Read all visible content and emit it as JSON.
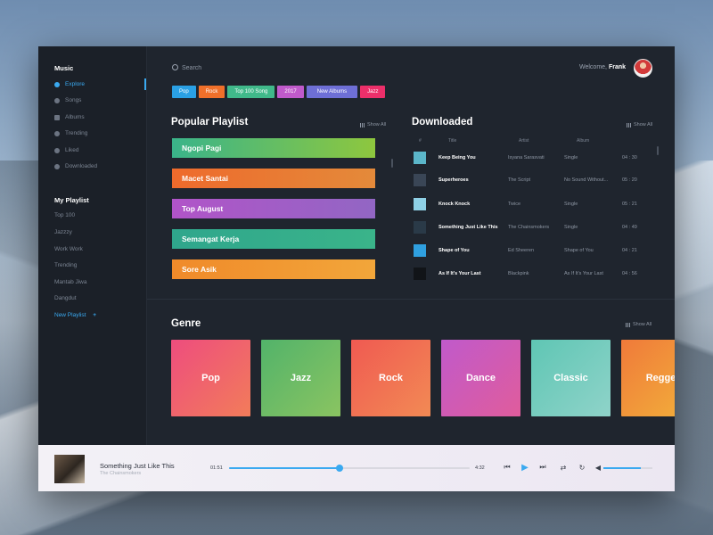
{
  "sidebar": {
    "title": "Music",
    "items": [
      {
        "label": "Explore",
        "icon": "compass-icon",
        "active": true
      },
      {
        "label": "Songs",
        "icon": "music-note-icon"
      },
      {
        "label": "Albums",
        "icon": "album-icon"
      },
      {
        "label": "Trending",
        "icon": "star-icon"
      },
      {
        "label": "Liked",
        "icon": "heart-icon"
      },
      {
        "label": "Downloaded",
        "icon": "cloud-download-icon"
      }
    ],
    "my_playlist_title": "My Playlist",
    "playlists": [
      "Top 100",
      "Jazzzy",
      "Work Work",
      "Trending",
      "Mantab Jiwa",
      "Dangdut"
    ],
    "new_playlist_label": "New Playlist",
    "new_playlist_plus": "+"
  },
  "header": {
    "search_placeholder": "Search",
    "welcome_prefix": "Welcome, ",
    "user_name": "Frank"
  },
  "tags": [
    {
      "label": "Pop",
      "color": "#2aa0e4"
    },
    {
      "label": "Rock",
      "color": "#f0702a"
    },
    {
      "label": "Top 100 Song",
      "color": "#40b98a"
    },
    {
      "label": "2017",
      "color": "#c05acb"
    },
    {
      "label": "New Albums",
      "color": "#6e6fd6"
    },
    {
      "label": "Jazz",
      "color": "#ec2f6a"
    }
  ],
  "popular": {
    "title": "Popular Playlist",
    "show_all": "Show All",
    "items": [
      {
        "label": "Ngopi Pagi",
        "from": "#3ab48a",
        "to": "#8ec73e"
      },
      {
        "label": "Macet Santai",
        "from": "#ee6a2c",
        "to": "#e48a3a"
      },
      {
        "label": "Top August",
        "from": "#b154c8",
        "to": "#9266c4"
      },
      {
        "label": "Semangat Kerja",
        "from": "#2fa68c",
        "to": "#3ab48a"
      },
      {
        "label": "Sore Asik",
        "from": "#f08a2a",
        "to": "#f2a63a"
      }
    ]
  },
  "downloaded": {
    "title": "Downloaded",
    "show_all": "Show All",
    "headers": {
      "num": "#",
      "title": "Title",
      "artist": "Artist",
      "album": "Album"
    },
    "rows": [
      {
        "title": "Keep Being You",
        "artist": "Isyana Sarasvati",
        "album": "Single",
        "time": "04 : 30",
        "thumb": "#5bb6c9"
      },
      {
        "title": "Superheroes",
        "artist": "The Script",
        "album": "No Sound Without...",
        "time": "05 : 20",
        "thumb": "#3a4656"
      },
      {
        "title": "Knock Knock",
        "artist": "Twice",
        "album": "Single",
        "time": "05 : 21",
        "thumb": "#8fd1e6"
      },
      {
        "title": "Something Just Like This",
        "artist": "The Chainsmokers",
        "album": "Single",
        "time": "04 : 49",
        "thumb": "#2a3a48"
      },
      {
        "title": "Shape of You",
        "artist": "Ed Sheeren",
        "album": "Shape of You",
        "time": "04 : 21",
        "thumb": "#2fa0e0"
      },
      {
        "title": "As If It's Your Last",
        "artist": "Blackpink",
        "album": "As If It's Your Last",
        "time": "04 : 56",
        "thumb": "#111418"
      }
    ]
  },
  "genre": {
    "title": "Genre",
    "show_all": "Show All",
    "items": [
      {
        "label": "Pop",
        "from": "#ee4d7e",
        "to": "#f27c5a"
      },
      {
        "label": "Jazz",
        "from": "#52b36a",
        "to": "#8ac461"
      },
      {
        "label": "Rock",
        "from": "#f05a52",
        "to": "#f28a54"
      },
      {
        "label": "Dance",
        "from": "#c05acb",
        "to": "#e05c9c"
      },
      {
        "label": "Classic",
        "from": "#5fc6b4",
        "to": "#8fd3c9"
      },
      {
        "label": "Regge",
        "from": "#f07a3a",
        "to": "#f2b23a"
      }
    ]
  },
  "player": {
    "title": "Something Just Like This",
    "artist": "The Chainsmokers",
    "current_time": "01:51",
    "total_time": "4:32",
    "progress": 0.46,
    "volume": 0.76
  }
}
